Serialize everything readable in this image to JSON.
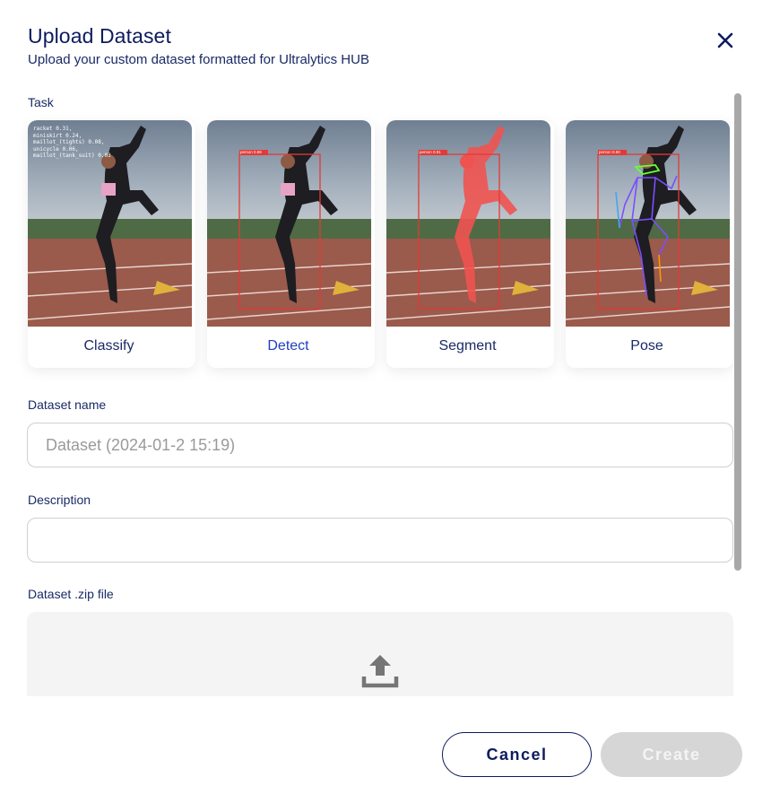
{
  "dialog": {
    "title": "Upload Dataset",
    "subtitle": "Upload your custom dataset formatted for Ultralytics HUB",
    "close_icon": "close-icon"
  },
  "task": {
    "label": "Task",
    "selected": "Detect",
    "options": [
      {
        "label": "Classify",
        "overlay_lines": [
          "racket 0.31,",
          "miniskirt 0.24,",
          "maillot_(tights) 0.08,",
          "unicycle 0.06,",
          "maillot_(tank_suit) 0.03"
        ]
      },
      {
        "label": "Detect",
        "box_label": "person 0.89"
      },
      {
        "label": "Segment",
        "box_label": "person 0.91"
      },
      {
        "label": "Pose",
        "box_label": "person 0.90"
      }
    ]
  },
  "dataset_name": {
    "label": "Dataset name",
    "placeholder": "Dataset (2024-01-2 15:19)",
    "value": ""
  },
  "description": {
    "label": "Description",
    "placeholder": "",
    "value": ""
  },
  "zip_file": {
    "label": "Dataset .zip file",
    "icon": "upload-icon"
  },
  "actions": {
    "cancel": "Cancel",
    "create": "Create"
  },
  "colors": {
    "primary": "#0d1b5e",
    "selected_text": "#1f3fbf",
    "disabled": "#d6d6d6",
    "detect_box": "#e53935",
    "segment_mask": "#ef5350",
    "pose_skeleton": "#7c4dff"
  }
}
